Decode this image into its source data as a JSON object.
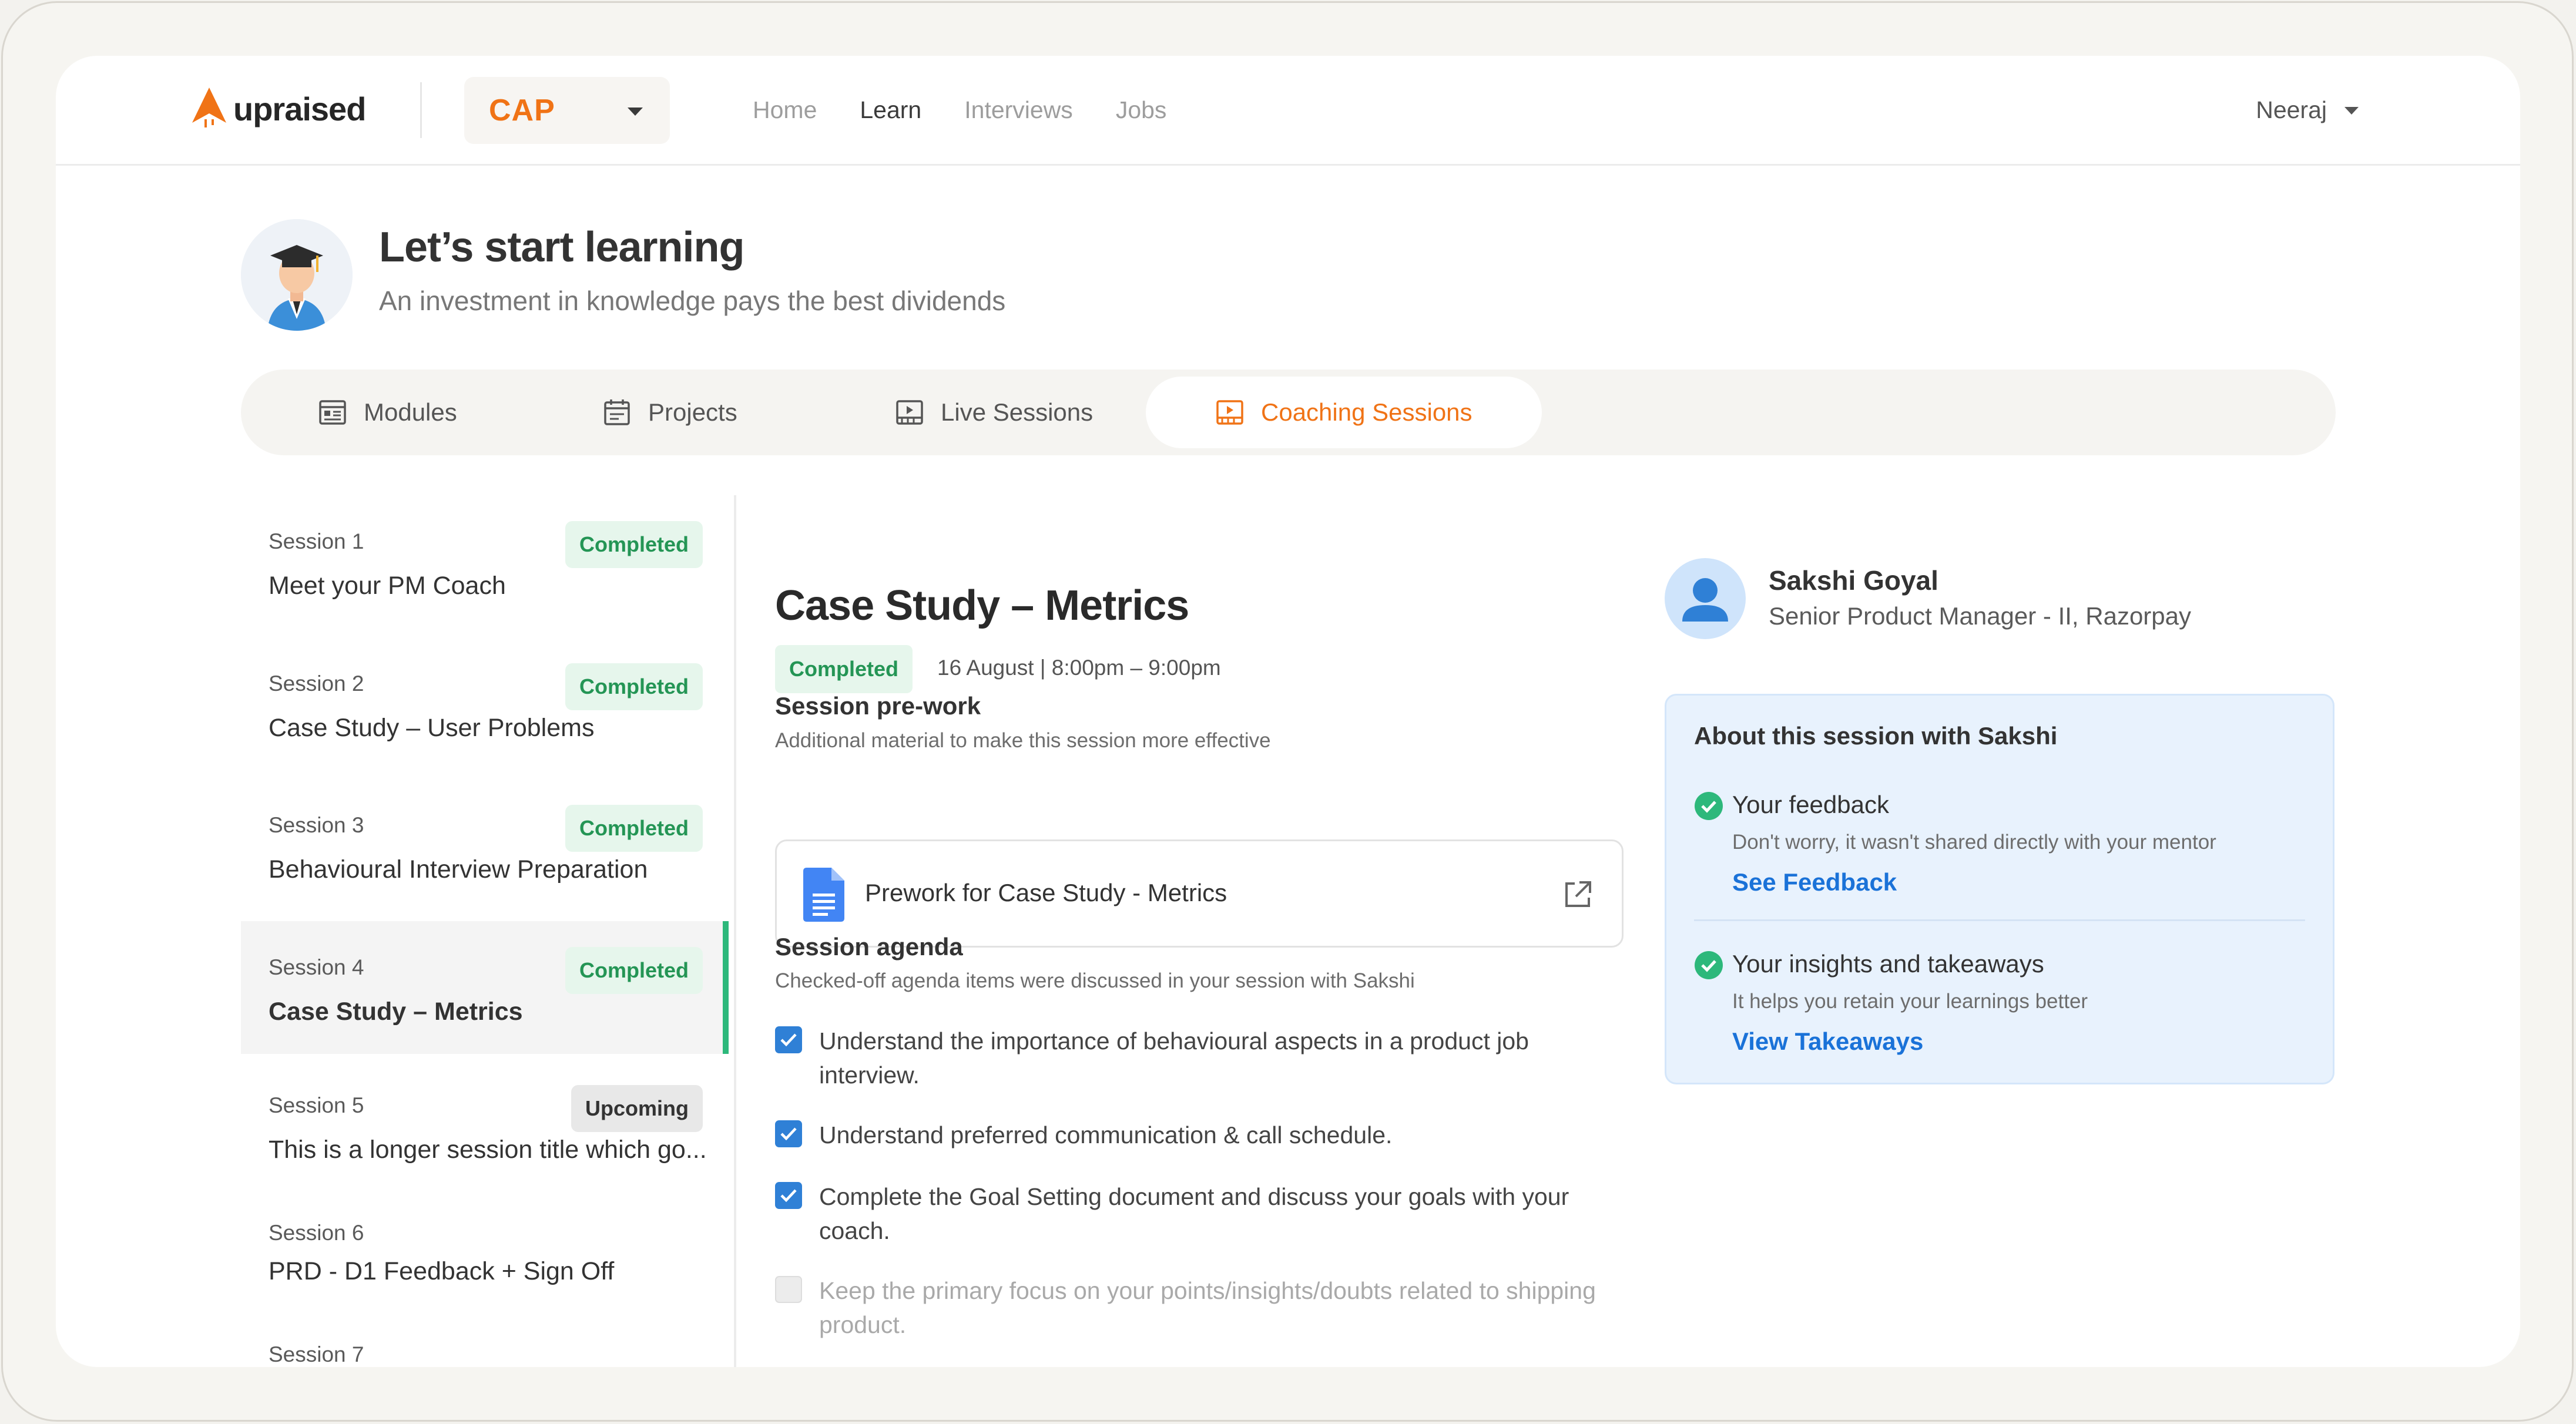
{
  "brand": {
    "name": "upraised",
    "accent": "#f07316",
    "success": "#249555",
    "link": "#1a72d8"
  },
  "program": {
    "selected": "CAP"
  },
  "nav": {
    "links": [
      "Home",
      "Learn",
      "Interviews",
      "Jobs"
    ],
    "active": "Learn"
  },
  "user": {
    "name": "Neeraj"
  },
  "hero": {
    "title": "Let’s start learning",
    "subtitle": "An investment in knowledge pays the best dividends"
  },
  "tabs": [
    {
      "label": "Modules",
      "icon": "modules-icon"
    },
    {
      "label": "Projects",
      "icon": "calendar-icon"
    },
    {
      "label": "Live Sessions",
      "icon": "live-video-icon"
    },
    {
      "label": "Coaching Sessions",
      "icon": "coaching-video-icon",
      "active": true
    }
  ],
  "sessions": [
    {
      "num": "Session 1",
      "title": "Meet your PM Coach",
      "status": "Completed"
    },
    {
      "num": "Session 2",
      "title": "Case Study – User Problems",
      "status": "Completed"
    },
    {
      "num": "Session 3",
      "title": "Behavioural Interview Preparation",
      "status": "Completed"
    },
    {
      "num": "Session 4",
      "title": "Case Study – Metrics",
      "status": "Completed",
      "active": true
    },
    {
      "num": "Session 5",
      "title": "This is a longer session title which go...",
      "status": "Upcoming"
    },
    {
      "num": "Session 6",
      "title": "PRD - D1 Feedback + Sign Off",
      "status": ""
    },
    {
      "num": "Session 7",
      "title": "",
      "status": ""
    }
  ],
  "detail": {
    "title": "Case Study – Metrics",
    "status": "Completed",
    "date": "16 August | 8:00pm – 9:00pm",
    "prework": {
      "title": "Session pre-work",
      "subtitle": "Additional material to make this session more effective",
      "doc_label": "Prework for Case Study  - Metrics"
    },
    "agenda": {
      "title": "Session agenda",
      "subtitle": "Checked-off agenda items were discussed in your session with Sakshi",
      "items": [
        {
          "text": "Understand the importance of behavioural aspects in a product job interview.",
          "checked": true
        },
        {
          "text": "Understand preferred communication & call schedule.",
          "checked": true
        },
        {
          "text": "Complete the Goal Setting document and discuss your goals with your coach.",
          "checked": true
        },
        {
          "text": "Keep the primary focus on your points/insights/doubts related to shipping product.",
          "checked": false
        }
      ]
    }
  },
  "mentor": {
    "name": "Sakshi Goyal",
    "role": "Senior Product Manager - II, Razorpay",
    "about": {
      "title": "About this session with Sakshi",
      "feedback": {
        "head": "Your feedback",
        "sub": "Don't worry, it wasn't shared directly with your mentor",
        "link": "See Feedback"
      },
      "insights": {
        "head": "Your insights and takeaways",
        "sub": "It helps you retain your learnings better",
        "link": "View Takeaways"
      }
    }
  }
}
